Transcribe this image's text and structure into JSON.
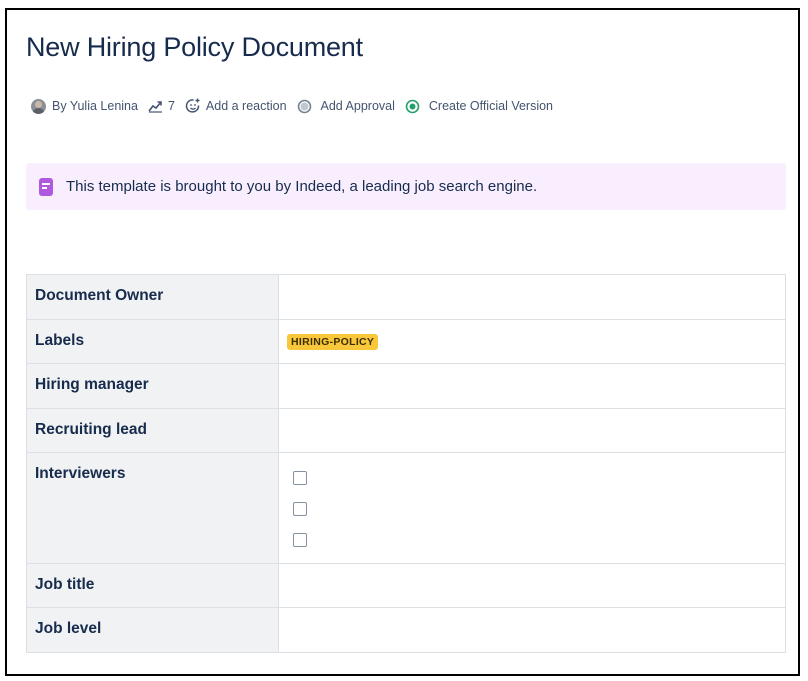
{
  "page": {
    "title": "New Hiring Policy Document"
  },
  "meta": {
    "author": "By Yulia Lenina",
    "views": "7",
    "reaction": "Add a reaction",
    "approval": "Add Approval",
    "official": "Create Official Version",
    "icons": [
      "avatar",
      "analytics-icon",
      "add-reaction-icon",
      "approval-status-icon",
      "official-version-icon"
    ],
    "colors": {
      "official_icon": "#22a06b"
    }
  },
  "panel": {
    "icon": "note-icon",
    "text": "This template is brought to you by Indeed, a leading job search engine.",
    "colors": {
      "background": "#f8eefe",
      "icon": "#af59e1"
    }
  },
  "properties": {
    "rows": [
      {
        "label": "Document Owner"
      },
      {
        "label": "Labels",
        "tag": "HIRING-POLICY"
      },
      {
        "label": "Hiring manager"
      },
      {
        "label": "Recruiting lead"
      },
      {
        "label": "Interviewers",
        "checkboxes": 3
      },
      {
        "label": "Job title"
      },
      {
        "label": "Job level"
      }
    ],
    "colors": {
      "label_bg": "#f1f2f4",
      "tag_bg": "#f8c83a"
    }
  }
}
